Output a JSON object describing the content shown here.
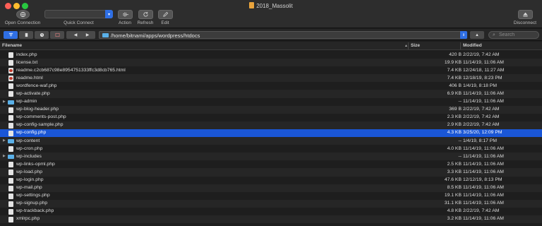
{
  "window": {
    "title": "2018_Massolit"
  },
  "toolbar": {
    "open_connection": "Open Connection",
    "quick_connect": "Quick Connect",
    "action": "Action",
    "refresh": "Refresh",
    "edit": "Edit",
    "disconnect": "Disconnect"
  },
  "pathbar": {
    "path": "/home/bitnami/apps/wordpress/htdocs",
    "search_placeholder": "Search"
  },
  "columns": {
    "filename": "Filename",
    "size": "Size",
    "modified": "Modified"
  },
  "files": [
    {
      "name": "index.php",
      "type": "file",
      "size": "420 B",
      "modified": "2/22/19, 7:42 AM"
    },
    {
      "name": "license.txt",
      "type": "file",
      "size": "19.9 KB",
      "modified": "11/14/19, 11:06 AM"
    },
    {
      "name": "readme.c2cb687c98e8954751333ffc3d8cb765.html",
      "type": "html",
      "size": "7.4 KB",
      "modified": "12/24/18, 11:27 AM"
    },
    {
      "name": "readme.html",
      "type": "html",
      "size": "7.4 KB",
      "modified": "12/18/19, 8:23 PM"
    },
    {
      "name": "wordfence-waf.php",
      "type": "file",
      "size": "406 B",
      "modified": "1/4/19, 8:18 PM"
    },
    {
      "name": "wp-activate.php",
      "type": "file",
      "size": "6.9 KB",
      "modified": "11/14/19, 11:06 AM"
    },
    {
      "name": "wp-admin",
      "type": "folder",
      "size": "--",
      "modified": "11/14/19, 11:06 AM"
    },
    {
      "name": "wp-blog-header.php",
      "type": "file",
      "size": "369 B",
      "modified": "2/22/19, 7:42 AM"
    },
    {
      "name": "wp-comments-post.php",
      "type": "file",
      "size": "2.3 KB",
      "modified": "2/22/19, 7:42 AM"
    },
    {
      "name": "wp-config-sample.php",
      "type": "file",
      "size": "2.9 KB",
      "modified": "2/22/19, 7:42 AM"
    },
    {
      "name": "wp-config.php",
      "type": "file",
      "size": "4.3 KB",
      "modified": "3/25/20, 12:09 PM",
      "selected": true
    },
    {
      "name": "wp-content",
      "type": "folder",
      "size": "--",
      "modified": "1/4/19, 8:17 PM"
    },
    {
      "name": "wp-cron.php",
      "type": "file",
      "size": "4.0 KB",
      "modified": "11/14/19, 11:06 AM"
    },
    {
      "name": "wp-includes",
      "type": "folder",
      "size": "--",
      "modified": "11/14/19, 11:06 AM"
    },
    {
      "name": "wp-links-opml.php",
      "type": "file",
      "size": "2.5 KB",
      "modified": "11/14/19, 11:06 AM"
    },
    {
      "name": "wp-load.php",
      "type": "file",
      "size": "3.3 KB",
      "modified": "11/14/19, 11:06 AM"
    },
    {
      "name": "wp-login.php",
      "type": "file",
      "size": "47.6 KB",
      "modified": "12/12/19, 8:13 PM"
    },
    {
      "name": "wp-mail.php",
      "type": "file",
      "size": "8.5 KB",
      "modified": "11/14/19, 11:06 AM"
    },
    {
      "name": "wp-settings.php",
      "type": "file",
      "size": "19.1 KB",
      "modified": "11/14/19, 11:06 AM"
    },
    {
      "name": "wp-signup.php",
      "type": "file",
      "size": "31.1 KB",
      "modified": "11/14/19, 11:06 AM"
    },
    {
      "name": "wp-trackback.php",
      "type": "file",
      "size": "4.8 KB",
      "modified": "2/22/19, 7:42 AM"
    },
    {
      "name": "xmlrpc.php",
      "type": "file",
      "size": "3.2 KB",
      "modified": "11/14/19, 11:06 AM"
    }
  ],
  "colors": {
    "selection": "#1a56d6",
    "accent": "#2f6fe4",
    "folder": "#5ab0e8"
  }
}
